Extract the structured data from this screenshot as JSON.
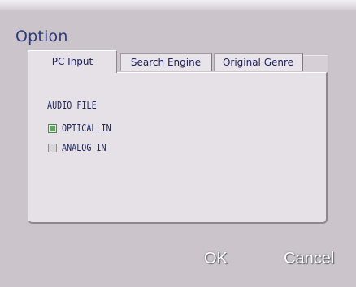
{
  "dialog": {
    "title": "Option"
  },
  "tabs": [
    {
      "label": "PC Input",
      "active": true
    },
    {
      "label": "Search Engine",
      "active": false
    },
    {
      "label": "Original Genre",
      "active": false
    }
  ],
  "pc_input": {
    "section_label": "AUDIO FILE",
    "options": [
      {
        "label": "OPTICAL IN",
        "selected": true
      },
      {
        "label": "ANALOG IN",
        "selected": false
      }
    ]
  },
  "buttons": {
    "ok": "OK",
    "cancel": "Cancel"
  },
  "colors": {
    "background": "#cbc4cb",
    "panel": "#e6e1e6",
    "title_text": "#2d3b78",
    "label_text": "#1e2768",
    "selected_indicator": "#5fa45f",
    "button_text": "#ffffff"
  }
}
